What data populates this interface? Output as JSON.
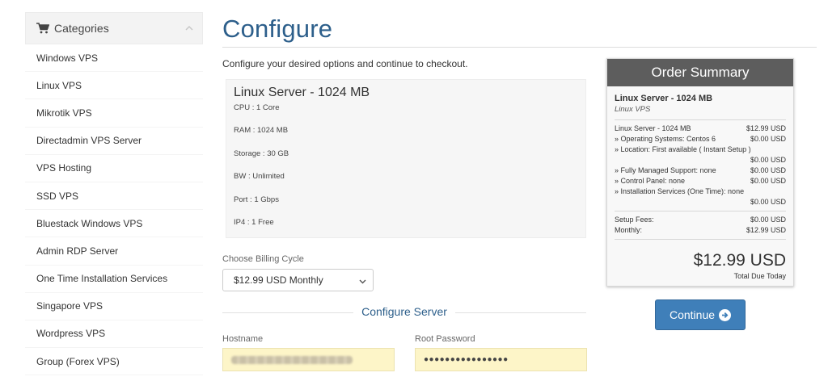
{
  "sidebar": {
    "title": "Categories",
    "icon": "shopping-cart-icon",
    "items": [
      {
        "label": "Windows VPS"
      },
      {
        "label": "Linux VPS"
      },
      {
        "label": "Mikrotik VPS"
      },
      {
        "label": "Directadmin VPS Server"
      },
      {
        "label": "VPS Hosting"
      },
      {
        "label": "SSD VPS"
      },
      {
        "label": "Bluestack Windows VPS"
      },
      {
        "label": "Admin RDP Server"
      },
      {
        "label": "One Time Installation Services"
      },
      {
        "label": "Singapore VPS"
      },
      {
        "label": "Wordpress VPS"
      },
      {
        "label": "Group (Forex VPS)"
      }
    ]
  },
  "main": {
    "title": "Configure",
    "intro": "Configure your desired options and continue to checkout.",
    "product": {
      "name": "Linux Server - 1024 MB",
      "specs": [
        "CPU : 1 Core",
        "RAM : 1024 MB",
        "Storage : 30 GB",
        "BW : Unlimited",
        "Port : 1 Gbps",
        "IP4 : 1 Free"
      ]
    },
    "billing": {
      "label": "Choose Billing Cycle",
      "selected": "$12.99 USD Monthly"
    },
    "configure_server": {
      "heading": "Configure Server",
      "hostname_label": "Hostname",
      "root_password_label": "Root Password",
      "root_password_value": "●●●●●●●●●●●●●●●●"
    }
  },
  "summary": {
    "title": "Order Summary",
    "product_name": "Linux Server - 1024 MB",
    "product_group": "Linux VPS",
    "lines": [
      {
        "label": "Linux Server - 1024 MB",
        "amount": "$12.99 USD"
      },
      {
        "label": "» Operating Systems: Centos 6",
        "amount": "$0.00 USD"
      },
      {
        "label": "» Location: First available ( Instant Setup )",
        "amount": "$0.00 USD"
      },
      {
        "label": "» Fully Managed Support: none",
        "amount": "$0.00 USD"
      },
      {
        "label": "» Control Panel: none",
        "amount": "$0.00 USD"
      },
      {
        "label": "» Installation Services (One Time): none",
        "amount": "$0.00 USD"
      }
    ],
    "setup_label": "Setup Fees:",
    "setup_amount": "$0.00 USD",
    "monthly_label": "Monthly:",
    "monthly_amount": "$12.99 USD",
    "total": "$12.99 USD",
    "total_label": "Total Due Today"
  },
  "actions": {
    "continue_label": "Continue"
  },
  "colors": {
    "accent": "#2d5f8b",
    "button": "#3f7fb9",
    "summary_header": "#5d5d5d",
    "input_highlight": "#fdf5c8"
  }
}
